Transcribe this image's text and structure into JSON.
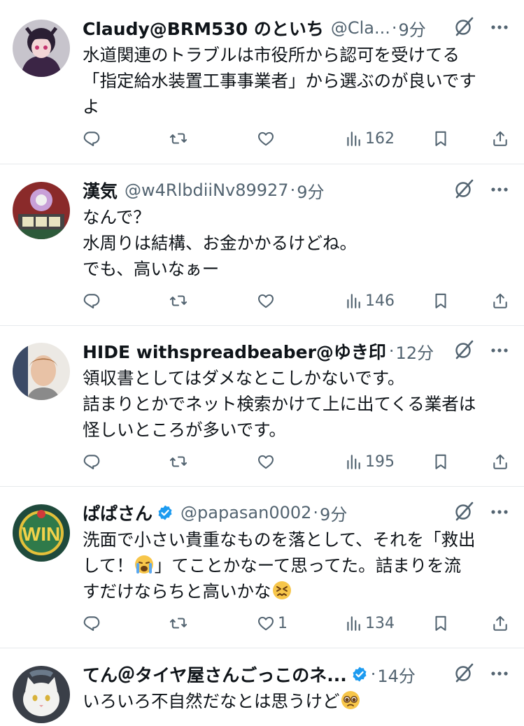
{
  "tweets": [
    {
      "name": "Claudy@BRM530 のといち",
      "handle": "@Cla...",
      "sep": "·",
      "time": "9分",
      "verified": false,
      "lines": [
        "水道関連のトラブルは市役所から認可を受けてる",
        "「指定給水装置工事事業者」から選ぶのが良いです",
        "よ"
      ],
      "likes": "",
      "views": "162",
      "avatar": "anime-avatar"
    },
    {
      "name": "漢気",
      "handle": "@w4RlbdiiNv89927",
      "sep": "·",
      "time": "9分",
      "verified": false,
      "lines": [
        "なんで？",
        "水周りは結構、お金かかるけどね。",
        "でも、高いなぁー"
      ],
      "likes": "",
      "views": "146",
      "avatar": "slot-machine-avatar"
    },
    {
      "name": "HIDE withspreadbeaber@ゆき印",
      "handle": "",
      "sep": "·",
      "time": "12分",
      "verified": false,
      "lines": [
        "領収書としてはダメなとこしかないです。",
        "詰まりとかでネット検索かけて上に出てくる業者は",
        "怪しいところが多いです。"
      ],
      "likes": "",
      "views": "195",
      "avatar": "photo-avatar"
    },
    {
      "name": "ぱぱさん",
      "handle": "@papasan0002",
      "sep": "·",
      "time": "9分",
      "verified": true,
      "lines": [
        "洗面で小さい貴重なものを落として、それを「救出",
        "して！",
        "」てことかなーて思ってた。詰まりを流",
        "すだけならちと高いかな"
      ],
      "likes": "1",
      "views": "134",
      "avatar": "win-avatar"
    },
    {
      "name": "てん＠タイヤ屋さんごっこのネ...",
      "handle": "",
      "sep": "·",
      "time": "14分",
      "verified": true,
      "lines": [
        "いろいろ不自然だなとは思うけど"
      ],
      "avatar": "cat-avatar"
    }
  ],
  "icons": {
    "reply": "reply-icon",
    "retweet": "retweet-icon",
    "like": "heart-icon",
    "views": "views-icon",
    "bookmark": "bookmark-icon",
    "share": "share-icon",
    "grok": "grok-icon",
    "more": "more-icon"
  },
  "colors": {
    "verified": "#1d9bf0",
    "secondary_text": "#536471",
    "divider": "#e6e9ec"
  }
}
